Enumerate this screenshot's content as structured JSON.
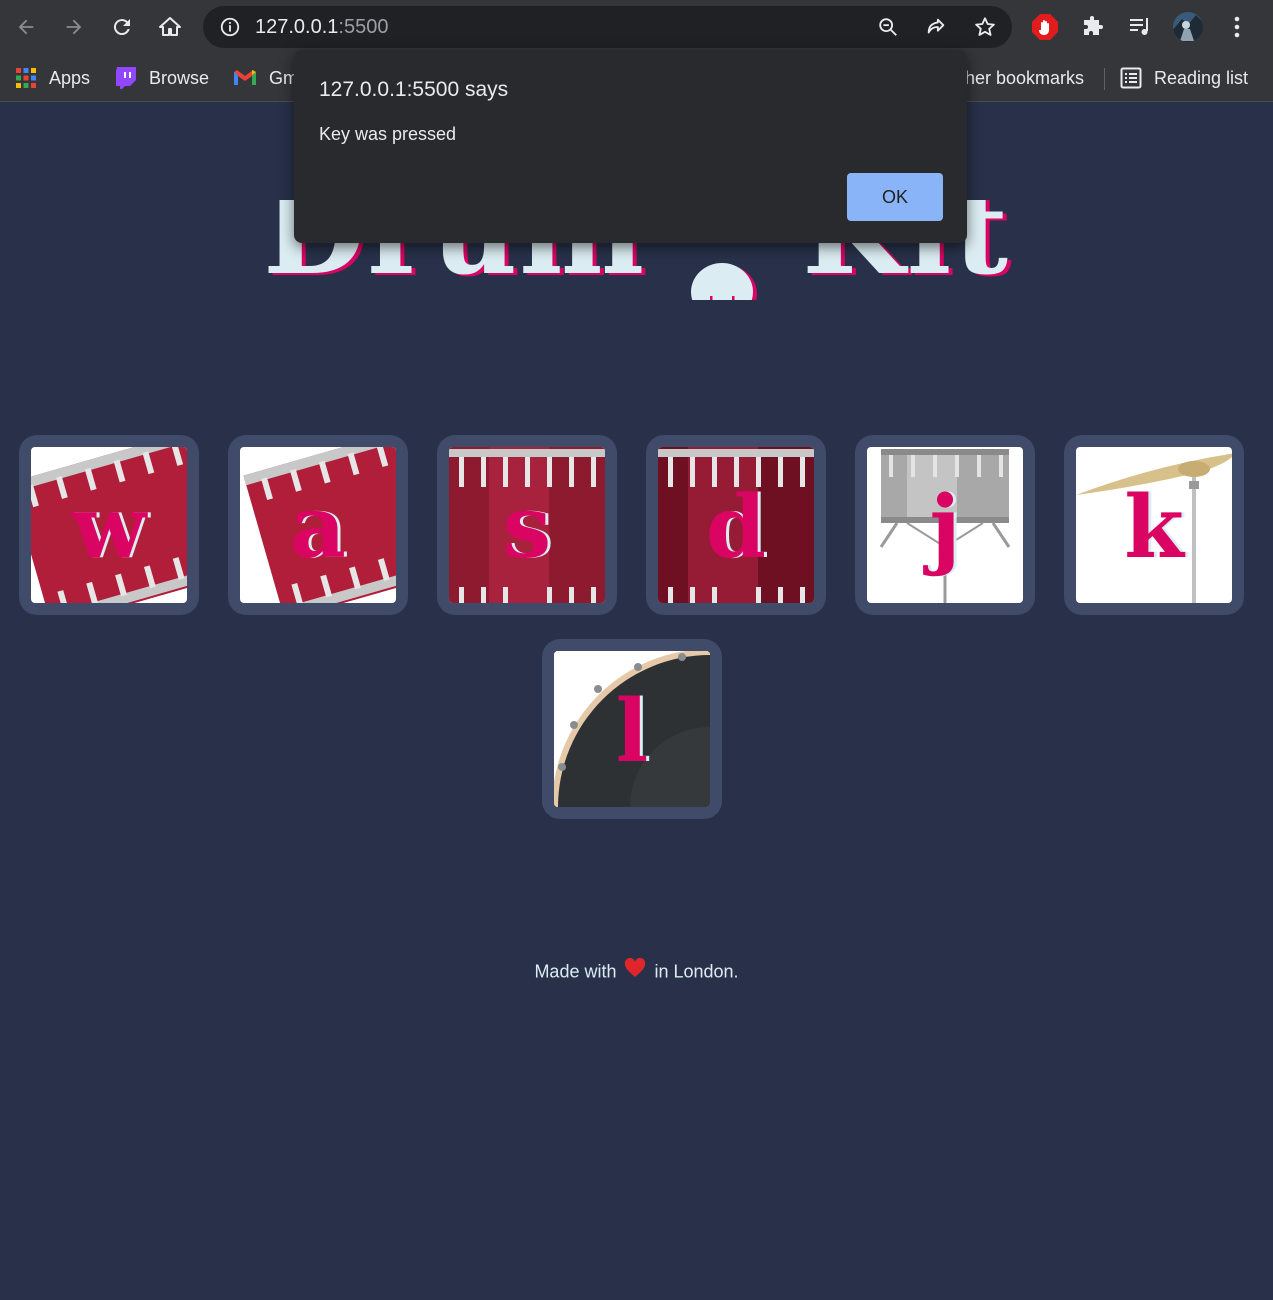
{
  "browser": {
    "url_host": "127.0.0.1",
    "url_port": ":5500",
    "bookmarks": {
      "apps_label": "Apps",
      "twitch_label": "Browse",
      "gmail_label": "Gm",
      "other_label": "ther bookmarks",
      "reading_list_label": "Reading list"
    }
  },
  "page": {
    "title_word_1": "Drum",
    "title_word_2": "Kit",
    "drums": [
      {
        "key": "w",
        "instrument": "tom"
      },
      {
        "key": "a",
        "instrument": "tom"
      },
      {
        "key": "s",
        "instrument": "tom"
      },
      {
        "key": "d",
        "instrument": "tom"
      },
      {
        "key": "j",
        "instrument": "snare"
      },
      {
        "key": "k",
        "instrument": "crash"
      },
      {
        "key": "l",
        "instrument": "kick"
      }
    ],
    "footer_before": "Made with",
    "footer_after": "in London."
  },
  "dialog": {
    "title": "127.0.0.1:5500 says",
    "message": "Key was pressed",
    "ok_label": "OK"
  },
  "colors": {
    "page_bg": "#283149",
    "tile_bg": "#404b69",
    "accent": "#da0463",
    "text": "#dbedf3",
    "dialog_button": "#8ab4f8"
  }
}
